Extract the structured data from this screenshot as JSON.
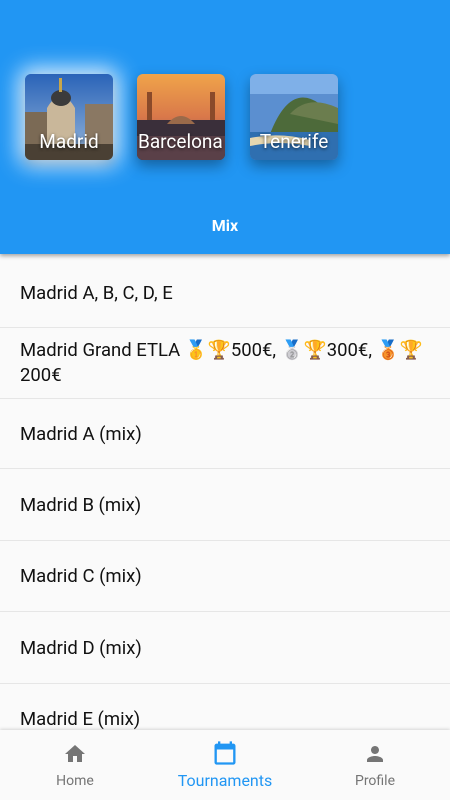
{
  "header": {
    "cities": [
      {
        "name": "Madrid",
        "selected": true
      },
      {
        "name": "Barcelona",
        "selected": false
      },
      {
        "name": "Tenerife",
        "selected": false
      }
    ],
    "tab_label": "Mix"
  },
  "tournaments": [
    {
      "title": "Madrid A, B, C, D, E"
    },
    {
      "title": "Madrid Grand ETLA 🥇🏆500€, 🥈🏆300€, 🥉🏆200€"
    },
    {
      "title": "Madrid A (mix)"
    },
    {
      "title": "Madrid B (mix)"
    },
    {
      "title": "Madrid C (mix)"
    },
    {
      "title": "Madrid D (mix)"
    },
    {
      "title": "Madrid E (mix)"
    }
  ],
  "bottom_nav": {
    "items": [
      {
        "label": "Home",
        "icon": "home-icon",
        "active": false
      },
      {
        "label": "Tournaments",
        "icon": "calendar-icon",
        "active": true
      },
      {
        "label": "Profile",
        "icon": "person-icon",
        "active": false
      }
    ]
  },
  "colors": {
    "primary": "#2196f3",
    "inactive": "#757575"
  }
}
